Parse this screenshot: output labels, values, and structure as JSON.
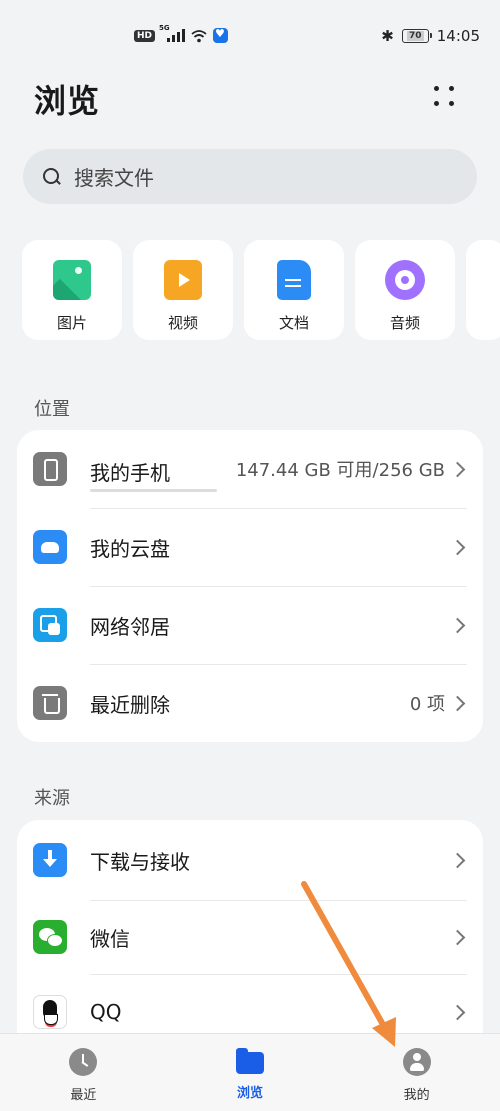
{
  "status_bar": {
    "hd_badge": "HD",
    "network_type": "5G",
    "battery_level": "70",
    "time": "14:05",
    "bluetooth_glyph": "✱"
  },
  "header": {
    "title": "浏览",
    "more_icon": "more-dots-icon"
  },
  "search": {
    "placeholder": "搜索文件"
  },
  "categories": [
    {
      "label": "图片",
      "icon": "image-icon",
      "color": "#2ec78c"
    },
    {
      "label": "视频",
      "icon": "video-icon",
      "color": "#f6a623"
    },
    {
      "label": "文档",
      "icon": "document-icon",
      "color": "#2b8cf6"
    },
    {
      "label": "音频",
      "icon": "audio-icon",
      "color": "#a070ff"
    }
  ],
  "locations": {
    "title": "位置",
    "items": [
      {
        "label": "我的手机",
        "value": "147.44 GB 可用/256 GB",
        "icon": "phone-icon",
        "storage_used_fraction": 0.42
      },
      {
        "label": "我的云盘",
        "value": "",
        "icon": "cloud-icon"
      },
      {
        "label": "网络邻居",
        "value": "",
        "icon": "network-icon"
      },
      {
        "label": "最近删除",
        "value": "0 项",
        "icon": "trash-icon"
      }
    ]
  },
  "sources": {
    "title": "来源",
    "items": [
      {
        "label": "下载与接收",
        "icon": "download-icon"
      },
      {
        "label": "微信",
        "icon": "wechat-icon"
      },
      {
        "label": "QQ",
        "icon": "qq-icon"
      }
    ]
  },
  "bottom_nav": {
    "items": [
      {
        "label": "最近",
        "icon": "clock-icon",
        "active": false
      },
      {
        "label": "浏览",
        "icon": "folder-icon",
        "active": true
      },
      {
        "label": "我的",
        "icon": "person-icon",
        "active": false
      }
    ]
  },
  "colors": {
    "accent": "#1a5ee8",
    "background": "#f1f3f5",
    "annotation_arrow": "#f08a3c"
  }
}
